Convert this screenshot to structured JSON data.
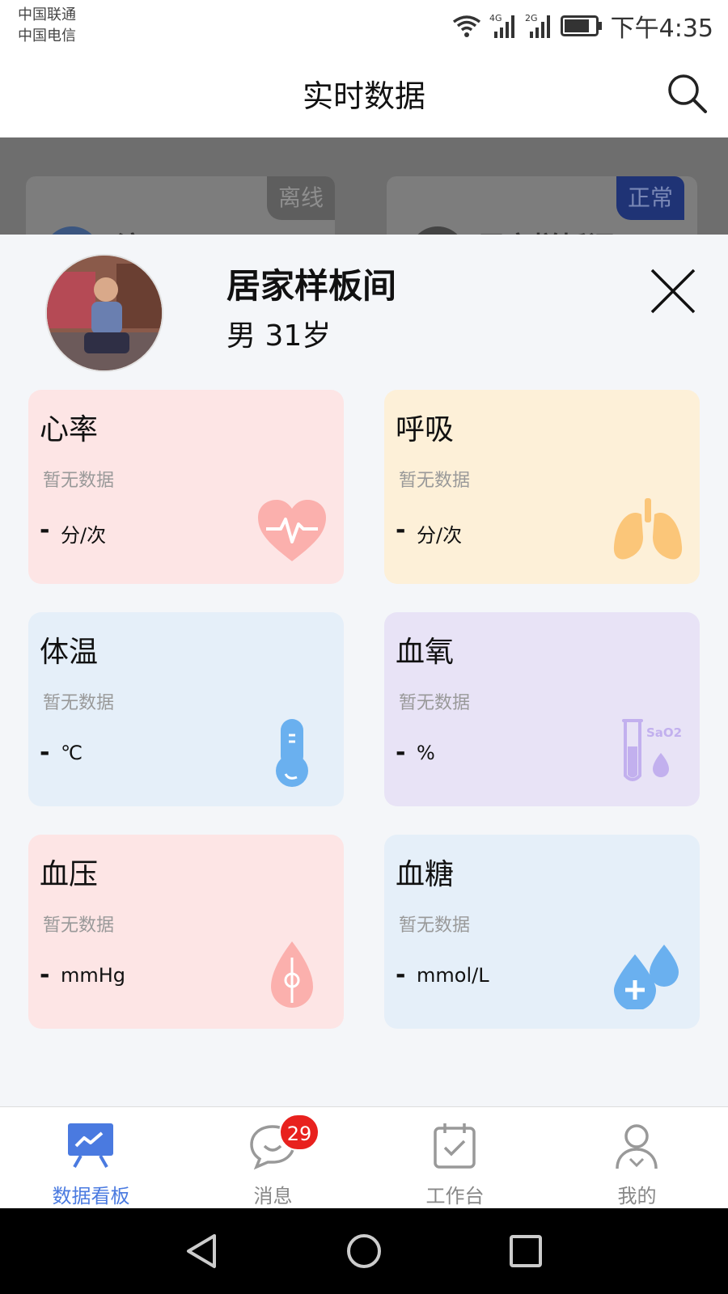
{
  "status_bar": {
    "carrier_1": "中国联通",
    "carrier_2": "中国电信",
    "net_1": "4G",
    "net_2": "2G",
    "time": "下午4:35"
  },
  "header": {
    "title": "实时数据",
    "search_icon": "search-icon"
  },
  "background_cards": [
    {
      "badge": "离线",
      "name": "演示"
    },
    {
      "badge": "正常",
      "name": "居家样板间"
    }
  ],
  "person": {
    "name": "居家样板间",
    "info": "男 31岁",
    "close_icon": "close-icon"
  },
  "vitals": [
    {
      "title": "心率",
      "status": "暂无数据",
      "value": "-",
      "unit": "分/次",
      "icon": "heart-rate-icon",
      "bg": "#fde5e5",
      "icon_color": "#fbb0ad"
    },
    {
      "title": "呼吸",
      "status": "暂无数据",
      "value": "-",
      "unit": "分/次",
      "icon": "lungs-icon",
      "bg": "#fdf0d8",
      "icon_color": "#fbc679"
    },
    {
      "title": "体温",
      "status": "暂无数据",
      "value": "-",
      "unit": "℃",
      "icon": "thermometer-icon",
      "bg": "#e5eff9",
      "icon_color": "#6ab0ef"
    },
    {
      "title": "血氧",
      "status": "暂无数据",
      "value": "-",
      "unit": "%",
      "icon": "blood-oxygen-icon",
      "icon_text": "SaO2",
      "bg": "#e8e3f6",
      "icon_color": "#c2b0ee"
    },
    {
      "title": "血压",
      "status": "暂无数据",
      "value": "-",
      "unit": "mmHg",
      "icon": "blood-pressure-icon",
      "bg": "#fde5e5",
      "icon_color": "#fbb0ad"
    },
    {
      "title": "血糖",
      "status": "暂无数据",
      "value": "-",
      "unit": "mmol/L",
      "icon": "blood-glucose-icon",
      "bg": "#e5eff9",
      "icon_color": "#6ab0ef"
    }
  ],
  "bottom_nav": [
    {
      "label": "数据看板",
      "icon": "dashboard-icon",
      "active": true
    },
    {
      "label": "消息",
      "icon": "message-icon",
      "badge": "29"
    },
    {
      "label": "工作台",
      "icon": "calendar-check-icon"
    },
    {
      "label": "我的",
      "icon": "profile-icon"
    }
  ],
  "colors": {
    "accent": "#4a7ae0",
    "badge_red": "#e8211e",
    "offline_badge": "#5e5e5e",
    "normal_badge": "#1f3375"
  }
}
